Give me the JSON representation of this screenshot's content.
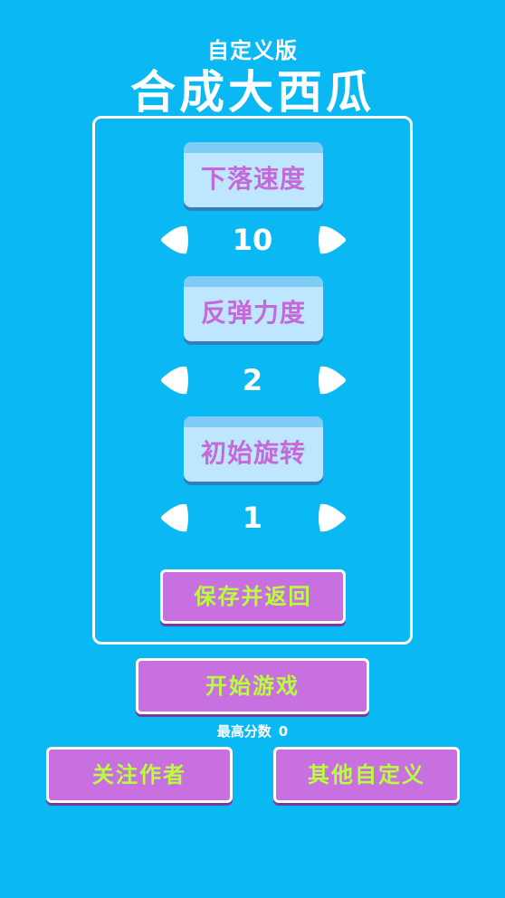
{
  "header": {
    "subtitle": "自定义版",
    "title": "合成大西瓜"
  },
  "settings": [
    {
      "label": "下落速度",
      "value": "10"
    },
    {
      "label": "反弹力度",
      "value": "2"
    },
    {
      "label": "初始旋转",
      "value": "1"
    }
  ],
  "buttons": {
    "save_return": "保存并返回",
    "start_game": "开始游戏",
    "follow_author": "关注作者",
    "other_custom": "其他自定义"
  },
  "highscore": {
    "label": "最高分数",
    "value": "0"
  },
  "colors": {
    "background": "#0ab8f3",
    "button_fill": "#c970e0",
    "button_text": "#b8ff3c",
    "label_text": "#c36ad8"
  },
  "icons": {
    "decrease": "arrow-left-icon",
    "increase": "arrow-right-icon"
  }
}
